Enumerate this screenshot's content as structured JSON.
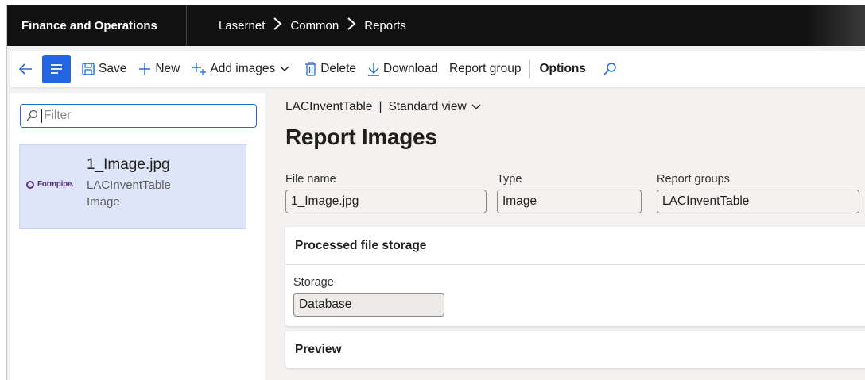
{
  "topbar": {
    "app_title": "Finance and Operations",
    "breadcrumbs": [
      "Lasernet",
      "Common",
      "Reports"
    ]
  },
  "toolbar": {
    "save_label": "Save",
    "new_label": "New",
    "add_images_label": "Add images",
    "delete_label": "Delete",
    "download_label": "Download",
    "report_group_label": "Report group",
    "options_label": "Options"
  },
  "list": {
    "filter_placeholder": "Filter",
    "items": [
      {
        "title": "1_Image.jpg",
        "line1": "LACInventTable",
        "line2": "Image",
        "logo_text": "Formpipe."
      }
    ]
  },
  "main": {
    "view_table": "LACInventTable",
    "view_name": "Standard view",
    "page_title": "Report Images",
    "fields": {
      "file_name_label": "File name",
      "file_name_value": "1_Image.jpg",
      "type_label": "Type",
      "type_value": "Image",
      "report_groups_label": "Report groups",
      "report_groups_value": "LACInventTable"
    },
    "storage_card": {
      "header": "Processed file storage",
      "storage_label": "Storage",
      "storage_value": "Database"
    },
    "preview_card": {
      "header": "Preview"
    }
  },
  "colors": {
    "accent": "#2266e3",
    "topbar": "#111111",
    "selected_item": "#dce6f8"
  }
}
